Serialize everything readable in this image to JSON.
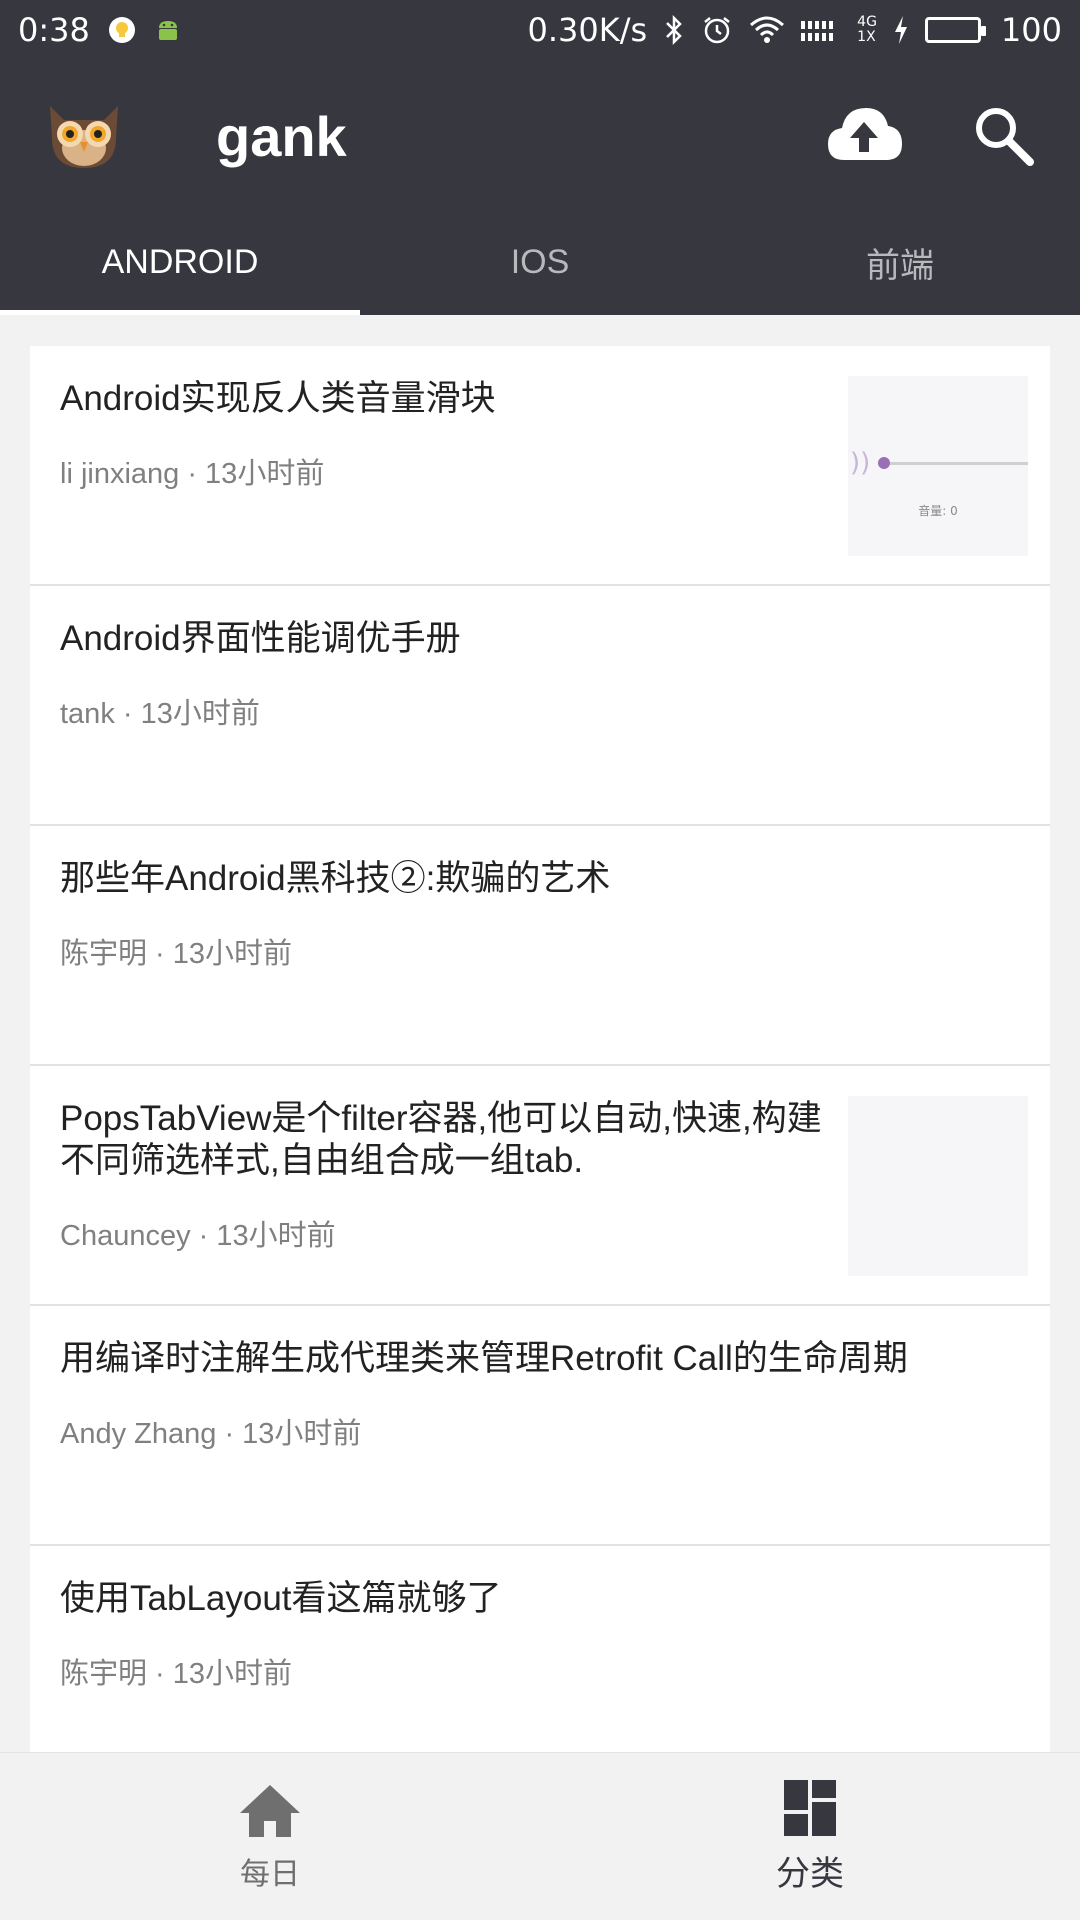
{
  "status_bar": {
    "time": "0:38",
    "net_speed": "0.30K/s",
    "network_top": "4G",
    "network_bottom": "1X",
    "battery": "100",
    "battery_level": 1.0
  },
  "app_bar": {
    "title": "gank",
    "logo_icon": "owl-icon",
    "upload_icon": "cloud-upload-icon",
    "search_icon": "search-icon"
  },
  "tabs": [
    {
      "label": "ANDROID",
      "active": true
    },
    {
      "label": "IOS",
      "active": false
    },
    {
      "label": "前端",
      "active": false
    }
  ],
  "items": [
    {
      "title": "Android实现反人类音量滑块",
      "meta": "li jinxiang · 13小时前",
      "thumb_label": "音量: 0"
    },
    {
      "title": "Android界面性能调优手册",
      "meta": "tank · 13小时前"
    },
    {
      "title": "那些年Android黑科技②:欺骗的艺术",
      "meta": "陈宇明 · 13小时前"
    },
    {
      "title": "PopsTabView是个filter容器,他可以自动,快速,构建不同筛选样式,自由组合成一组tab.",
      "meta": "Chauncey · 13小时前"
    },
    {
      "title": "用编译时注解生成代理类来管理Retrofit Call的生命周期",
      "meta": "Andy Zhang · 13小时前"
    },
    {
      "title": "使用TabLayout看这篇就够了",
      "meta": "陈宇明 · 13小时前"
    }
  ],
  "bottom_nav": [
    {
      "label": "每日",
      "icon": "home-icon",
      "active": false
    },
    {
      "label": "分类",
      "icon": "dashboard-icon",
      "active": true
    }
  ],
  "colors": {
    "primary": "#37373f",
    "accent": "#ffffff",
    "battery": "#7ed957"
  }
}
